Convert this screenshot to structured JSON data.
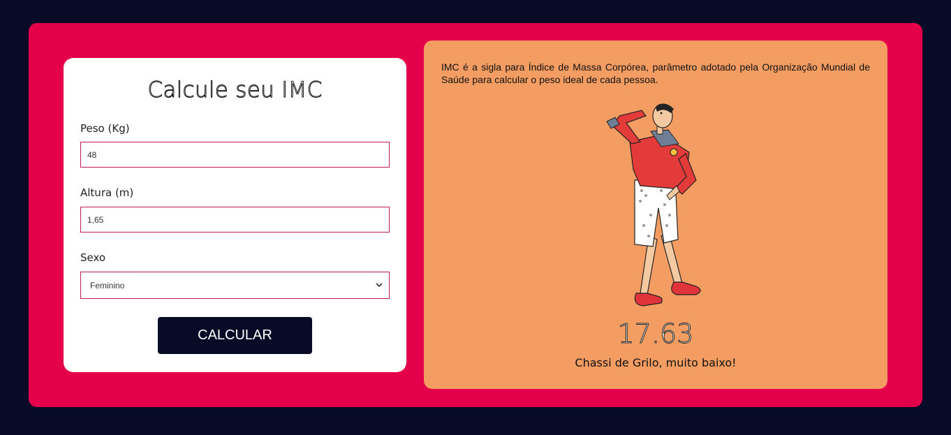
{
  "form": {
    "title": "Calcule seu IMC",
    "weight_label": "Peso (Kg)",
    "weight_value": "48",
    "height_label": "Altura (m)",
    "height_value": "1,65",
    "sex_label": "Sexo",
    "sex_selected": "Feminino",
    "calculate_label": "CALCULAR"
  },
  "info": {
    "description": "IMC é a sigla para Índice de Massa Corpórea, parâmetro adotado pela Organização Mundial de Saúde para calcular o peso ideal de cada pessoa.",
    "illustration": "olive-oyl-character",
    "bmi_value": "17.63",
    "bmi_message": "Chassi de Grilo, muito baixo!"
  },
  "colors": {
    "background": "#070b26",
    "accent": "#e5004c",
    "info_panel": "#f49d63",
    "button": "#070b26"
  }
}
